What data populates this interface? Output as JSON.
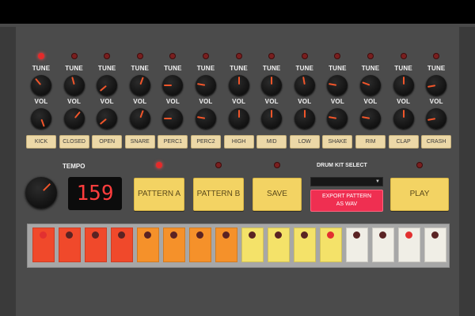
{
  "colors": {
    "panel": "#4b4b4b",
    "accent_red": "#e52a2a",
    "knob_indicator": "#f0552a",
    "button_yellow": "#f3d363",
    "export_red": "#ef2f51"
  },
  "channels": [
    {
      "name": "KICK",
      "tune_label": "TUNE",
      "vol_label": "VOL",
      "led_on": true,
      "tune_angle": -40,
      "vol_angle": 160
    },
    {
      "name": "CLOSED",
      "tune_label": "TUNE",
      "vol_label": "VOL",
      "led_on": false,
      "tune_angle": -15,
      "vol_angle": 40
    },
    {
      "name": "OPEN",
      "tune_label": "TUNE",
      "vol_label": "VOL",
      "led_on": false,
      "tune_angle": -130,
      "vol_angle": -130
    },
    {
      "name": "SNARE",
      "tune_label": "TUNE",
      "vol_label": "VOL",
      "led_on": false,
      "tune_angle": 20,
      "vol_angle": 20
    },
    {
      "name": "PERC1",
      "tune_label": "TUNE",
      "vol_label": "VOL",
      "led_on": false,
      "tune_angle": -90,
      "vol_angle": -90
    },
    {
      "name": "PERC2",
      "tune_label": "TUNE",
      "vol_label": "VOL",
      "led_on": false,
      "tune_angle": -80,
      "vol_angle": -80
    },
    {
      "name": "HIGH",
      "tune_label": "TUNE",
      "vol_label": "VOL",
      "led_on": false,
      "tune_angle": 0,
      "vol_angle": 0
    },
    {
      "name": "MID",
      "tune_label": "TUNE",
      "vol_label": "VOL",
      "led_on": false,
      "tune_angle": 0,
      "vol_angle": 0
    },
    {
      "name": "LOW",
      "tune_label": "TUNE",
      "vol_label": "VOL",
      "led_on": false,
      "tune_angle": -10,
      "vol_angle": 0
    },
    {
      "name": "SHAKE",
      "tune_label": "TUNE",
      "vol_label": "VOL",
      "led_on": false,
      "tune_angle": -80,
      "vol_angle": -80
    },
    {
      "name": "RIM",
      "tune_label": "TUNE",
      "vol_label": "VOL",
      "led_on": false,
      "tune_angle": -70,
      "vol_angle": -80
    },
    {
      "name": "CLAP",
      "tune_label": "TUNE",
      "vol_label": "VOL",
      "led_on": false,
      "tune_angle": 0,
      "vol_angle": 0
    },
    {
      "name": "CRASH",
      "tune_label": "TUNE",
      "vol_label": "VOL",
      "led_on": false,
      "tune_angle": -100,
      "vol_angle": -100
    }
  ],
  "tempo": {
    "label": "TEMPO",
    "value": "159"
  },
  "buttons": {
    "pattern_a": "PATTERN A",
    "pattern_b": "PATTERN B",
    "save": "SAVE",
    "play": "PLAY"
  },
  "button_leds": {
    "pattern_a_on": true,
    "pattern_b_on": false,
    "save_on": false,
    "play_on": false
  },
  "drum_kit": {
    "label": "DRUM KIT SELECT",
    "selected": ""
  },
  "export": {
    "line1": "EXPORT PATTERN",
    "line2": "AS WAV"
  },
  "steps": [
    {
      "color": "#f0492b",
      "dot_on": true
    },
    {
      "color": "#f0492b",
      "dot_on": false
    },
    {
      "color": "#f0492b",
      "dot_on": false
    },
    {
      "color": "#f0492b",
      "dot_on": false
    },
    {
      "color": "#f5912a",
      "dot_on": false
    },
    {
      "color": "#f5912a",
      "dot_on": false
    },
    {
      "color": "#f5912a",
      "dot_on": false
    },
    {
      "color": "#f5912a",
      "dot_on": false
    },
    {
      "color": "#f4e269",
      "dot_on": false
    },
    {
      "color": "#f4e269",
      "dot_on": false
    },
    {
      "color": "#f4e269",
      "dot_on": false
    },
    {
      "color": "#f4e269",
      "dot_on": true
    },
    {
      "color": "#f0eee6",
      "dot_on": false
    },
    {
      "color": "#f0eee6",
      "dot_on": false
    },
    {
      "color": "#f0eee6",
      "dot_on": true
    },
    {
      "color": "#f0eee6",
      "dot_on": false
    }
  ]
}
